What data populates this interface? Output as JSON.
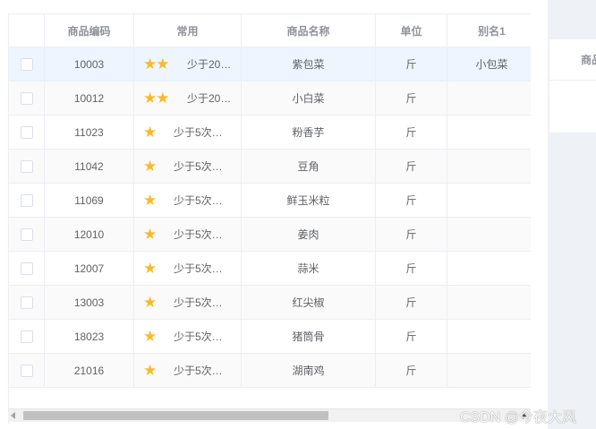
{
  "table": {
    "headers": {
      "checkbox": "",
      "code": "商品编码",
      "favorite": "常用",
      "name": "商品名称",
      "unit": "单位",
      "alias": "别名1"
    },
    "rows": [
      {
        "code": "10003",
        "stars": "★★",
        "fav_text": "少于20…",
        "name": "紫包菜",
        "unit": "斤",
        "alias": "小包菜",
        "state": "selected"
      },
      {
        "code": "10012",
        "stars": "★★",
        "fav_text": "少于20…",
        "name": "小白菜",
        "unit": "斤",
        "alias": "",
        "state": "striped"
      },
      {
        "code": "11023",
        "stars": "★",
        "fav_text": "少于5次…",
        "name": "粉香芋",
        "unit": "斤",
        "alias": "",
        "state": "normal"
      },
      {
        "code": "11042",
        "stars": "★",
        "fav_text": "少于5次…",
        "name": "豆角",
        "unit": "斤",
        "alias": "",
        "state": "striped"
      },
      {
        "code": "11069",
        "stars": "★",
        "fav_text": "少于5次…",
        "name": "鲜玉米粒",
        "unit": "斤",
        "alias": "",
        "state": "normal"
      },
      {
        "code": "12010",
        "stars": "★",
        "fav_text": "少于5次…",
        "name": "姜肉",
        "unit": "斤",
        "alias": "",
        "state": "striped"
      },
      {
        "code": "12007",
        "stars": "★",
        "fav_text": "少于5次…",
        "name": "蒜米",
        "unit": "斤",
        "alias": "",
        "state": "normal"
      },
      {
        "code": "13003",
        "stars": "★",
        "fav_text": "少于5次…",
        "name": "红尖椒",
        "unit": "斤",
        "alias": "",
        "state": "striped"
      },
      {
        "code": "18023",
        "stars": "★",
        "fav_text": "少于5次…",
        "name": "猪筒骨",
        "unit": "斤",
        "alias": "",
        "state": "normal"
      },
      {
        "code": "21016",
        "stars": "★",
        "fav_text": "少于5次…",
        "name": "湖南鸡",
        "unit": "斤",
        "alias": "",
        "state": "striped"
      }
    ]
  },
  "side_panel": {
    "header": "商品"
  },
  "scrollbar": {
    "position_fraction": 0.0,
    "visible_fraction": 0.62
  },
  "watermark": "CSDN @今夜大风",
  "colors": {
    "star": "#f7ba2a",
    "selected_row": "#eef5fe",
    "border": "#ebeef5",
    "header_text": "#909399"
  }
}
